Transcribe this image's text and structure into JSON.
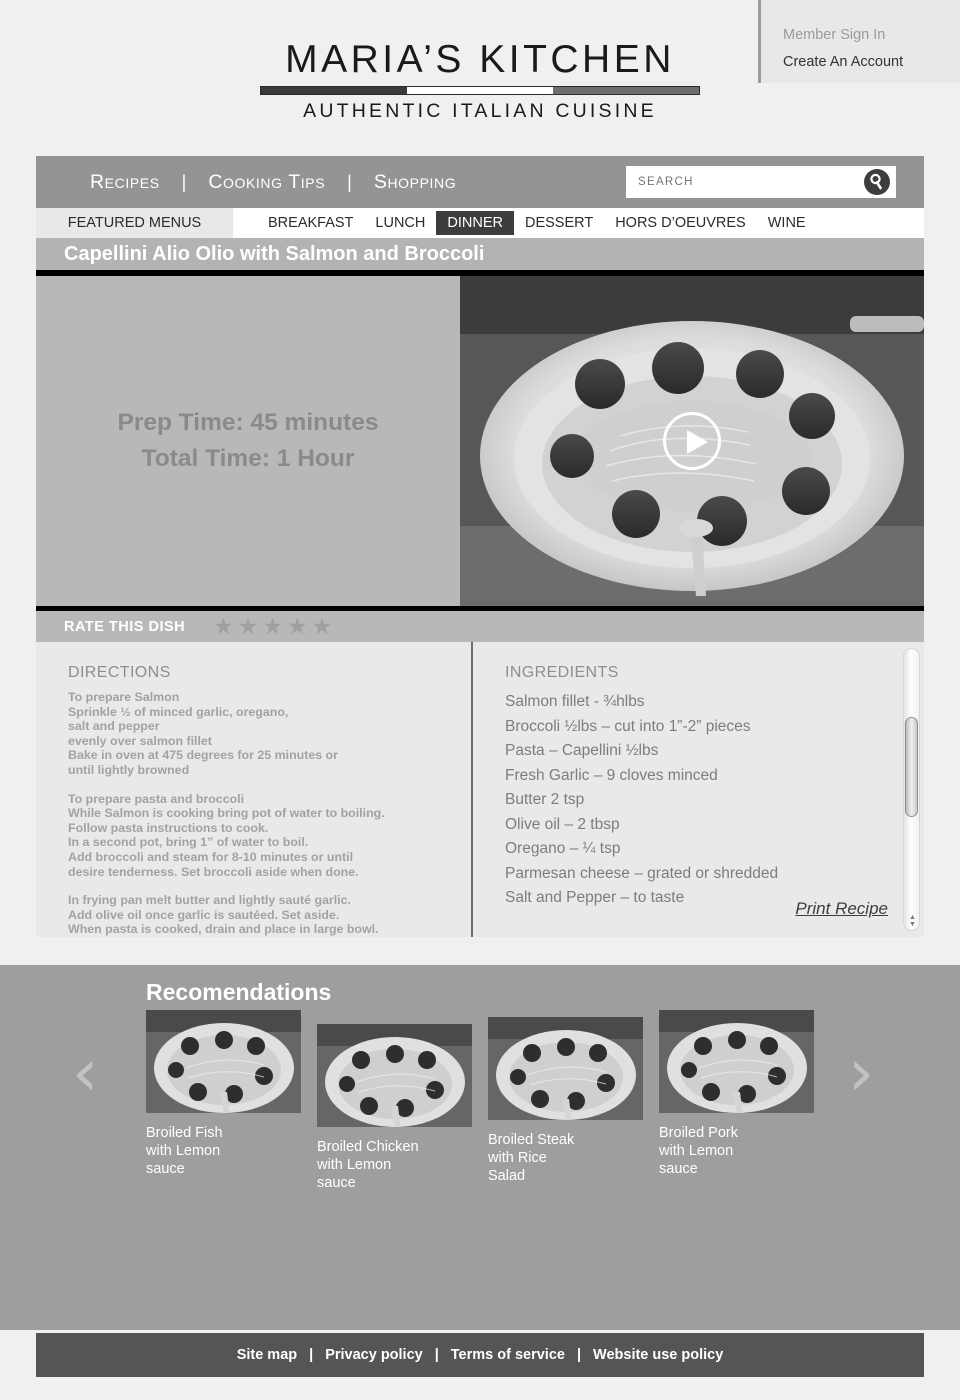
{
  "header": {
    "account": {
      "sign_in": "Member Sign In",
      "create_account": "Create An Account"
    },
    "logo": {
      "title": "MARIA’S KITCHEN",
      "subtitle": "AUTHENTIC ITALIAN CUISINE"
    }
  },
  "nav": {
    "items": [
      {
        "label": "Recipes"
      },
      {
        "label": "Cooking Tips"
      },
      {
        "label": "Shopping"
      }
    ],
    "separator": "|",
    "search": {
      "placeholder": "SEARCH",
      "value": "",
      "icon": "search-icon"
    }
  },
  "menustrip": {
    "featured_label": "FEATURED MENUS",
    "items": [
      {
        "label": "BREAKFAST",
        "active": false
      },
      {
        "label": "LUNCH",
        "active": false
      },
      {
        "label": "DINNER",
        "active": true
      },
      {
        "label": "DESSERT",
        "active": false
      },
      {
        "label": "HORS D’OEUVRES",
        "active": false
      },
      {
        "label": "WINE",
        "active": false
      }
    ]
  },
  "recipe": {
    "title": "Capellini Alio Olio with Salmon and Broccoli",
    "prep_time": "Prep Time: 45 minutes",
    "total_time": "Total Time:  1 Hour",
    "video": {
      "play_icon": "play-icon"
    }
  },
  "rating": {
    "label": "RATE THIS DISH",
    "stars_total": 5,
    "stars_filled": 0,
    "star_glyph": "★"
  },
  "directions": {
    "heading": "DIRECTIONS",
    "blocks": [
      [
        "To prepare Salmon",
        "Sprinkle ½ of minced garlic, oregano,",
        "salt and pepper",
        " evenly over salmon fillet",
        "Bake in oven at 475 degrees for 25 minutes or",
        "until lightly browned"
      ],
      [
        "To prepare pasta and broccoli",
        "While Salmon is cooking bring pot of water to boiling.",
        "Follow pasta instructions to cook.",
        "In a second pot, bring 1” of water to boil.",
        "Add broccoli and steam for 8-10 minutes or until",
        "desire tenderness. Set broccoli aside when done."
      ],
      [
        "In frying pan melt butter and lightly sauté garlic.",
        "Add olive oil once garlic is sautéed.  Set aside.",
        "When pasta is cooked, drain and place in large bowl."
      ]
    ]
  },
  "ingredients": {
    "heading": "INGREDIENTS",
    "items": [
      "Salmon fillet - ¾hlbs",
      "Broccoli ½lbs – cut into 1”-2” pieces",
      "Pasta – Capellini ½lbs",
      "Fresh Garlic – 9 cloves minced",
      "Butter 2 tsp",
      "Olive oil – 2 tbsp",
      "Oregano – ¼ tsp",
      "Parmesan cheese – grated or shredded",
      "Salt and Pepper – to taste"
    ],
    "print_link": "Print Recipe"
  },
  "recommendations": {
    "title": "Recomendations",
    "prev_glyph": "‹",
    "next_glyph": "›",
    "cards": [
      {
        "label": "Broiled Fish\nwith Lemon\nsauce"
      },
      {
        "label": "Broiled Chicken\nwith Lemon\nsauce"
      },
      {
        "label": "Broiled Steak\nwith Rice\nSalad"
      },
      {
        "label": "Broiled Pork\nwith Lemon\nsauce"
      }
    ]
  },
  "footer": {
    "links": [
      {
        "label": "Site map"
      },
      {
        "label": "Privacy policy"
      },
      {
        "label": "Terms of service"
      },
      {
        "label": "Website use policy"
      }
    ],
    "separator": "|"
  },
  "colors": {
    "page_bg": "#f0f0f0",
    "nav_bg": "#949494",
    "active_tab": "#3d3d3d",
    "title_bar": "#b3b3b3",
    "rate_bar": "#b8b8b8",
    "content_bg": "#e9e9e9",
    "recs_bg": "#9e9e9e",
    "footer_bg": "#555555"
  }
}
